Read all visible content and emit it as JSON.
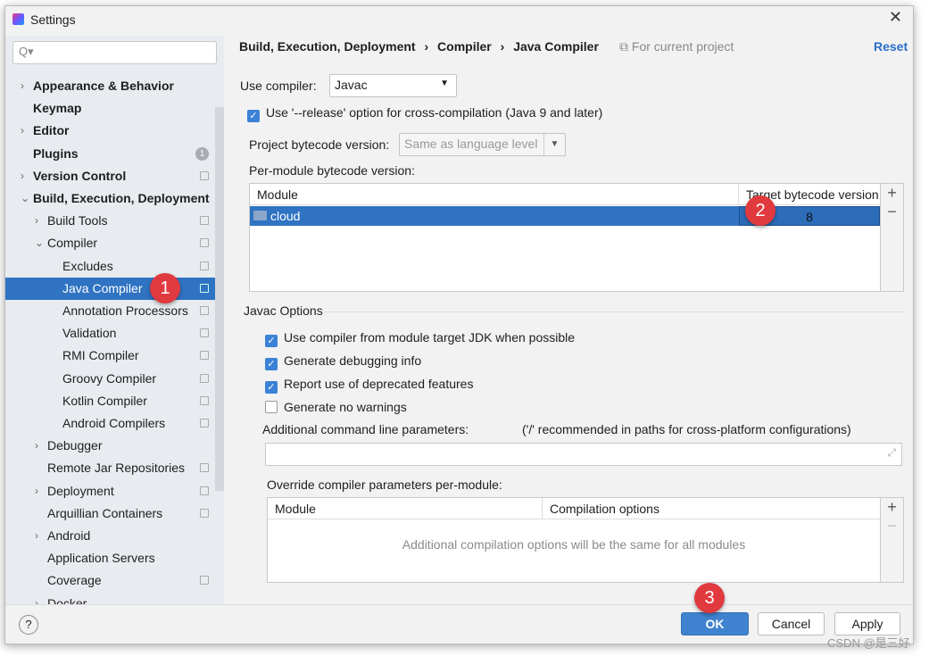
{
  "window": {
    "title": "Settings",
    "close": "✕"
  },
  "sidebar": {
    "search_placeholder": "Q▾",
    "items": [
      {
        "label": "Appearance & Behavior",
        "level": 0,
        "arrow": "›",
        "bold": true
      },
      {
        "label": "Keymap",
        "level": 0,
        "bold": true
      },
      {
        "label": "Editor",
        "level": 0,
        "arrow": "›",
        "bold": true
      },
      {
        "label": "Plugins",
        "level": 0,
        "bold": true,
        "badge": "1"
      },
      {
        "label": "Version Control",
        "level": 0,
        "arrow": "›",
        "bold": true,
        "copy": true
      },
      {
        "label": "Build, Execution, Deployment",
        "level": 0,
        "arrow": "⌄",
        "bold": true
      },
      {
        "label": "Build Tools",
        "level": 1,
        "arrow": "›",
        "copy": true
      },
      {
        "label": "Compiler",
        "level": 1,
        "arrow": "⌄",
        "copy": true
      },
      {
        "label": "Excludes",
        "level": 2,
        "copy": true
      },
      {
        "label": "Java Compiler",
        "level": 2,
        "copy": true,
        "selected": true
      },
      {
        "label": "Annotation Processors",
        "level": 2,
        "copy": true
      },
      {
        "label": "Validation",
        "level": 2,
        "copy": true
      },
      {
        "label": "RMI Compiler",
        "level": 2,
        "copy": true
      },
      {
        "label": "Groovy Compiler",
        "level": 2,
        "copy": true
      },
      {
        "label": "Kotlin Compiler",
        "level": 2,
        "copy": true
      },
      {
        "label": "Android Compilers",
        "level": 2,
        "copy": true
      },
      {
        "label": "Debugger",
        "level": 1,
        "arrow": "›"
      },
      {
        "label": "Remote Jar Repositories",
        "level": 1,
        "copy": true
      },
      {
        "label": "Deployment",
        "level": 1,
        "arrow": "›",
        "copy": true
      },
      {
        "label": "Arquillian Containers",
        "level": 1,
        "copy": true
      },
      {
        "label": "Android",
        "level": 1,
        "arrow": "›"
      },
      {
        "label": "Application Servers",
        "level": 1
      },
      {
        "label": "Coverage",
        "level": 1,
        "copy": true
      },
      {
        "label": "Docker",
        "level": 1,
        "arrow": "›"
      }
    ]
  },
  "breadcrumb": [
    "Build, Execution, Deployment",
    "Compiler",
    "Java Compiler"
  ],
  "breadcrumb_sep": "›",
  "for_current_project": "For current project",
  "reset": "Reset",
  "use_compiler": {
    "label": "Use compiler:",
    "value": "Javac"
  },
  "release_option": {
    "label": "Use '--release' option for cross-compilation (Java 9 and later)",
    "checked": true
  },
  "project_bytecode": {
    "label": "Project bytecode version:",
    "value": "Same as language level"
  },
  "per_module": {
    "label": "Per-module bytecode version:",
    "headers": [
      "Module",
      "Target bytecode version"
    ],
    "rows": [
      {
        "module": "cloud",
        "version": "8"
      }
    ],
    "add": "+",
    "remove": "−"
  },
  "javac": {
    "title": "Javac Options",
    "options": [
      {
        "label": "Use compiler from module target JDK when possible",
        "checked": true
      },
      {
        "label": "Generate debugging info",
        "checked": true
      },
      {
        "label": "Report use of deprecated features",
        "checked": true
      },
      {
        "label": "Generate no warnings",
        "checked": false
      }
    ],
    "additional_label": "Additional command line parameters:",
    "additional_hint": "('/' recommended in paths for cross-platform configurations)",
    "additional_value": "",
    "override_label": "Override compiler parameters per-module:",
    "override_headers": [
      "Module",
      "Compilation options"
    ],
    "override_empty": "Additional compilation options will be the same for all modules",
    "add": "+",
    "remove": "−"
  },
  "markers": [
    "1",
    "2",
    "3"
  ],
  "footer": {
    "help": "?",
    "ok": "OK",
    "cancel": "Cancel",
    "apply": "Apply"
  },
  "watermark": "CSDN @是三好"
}
